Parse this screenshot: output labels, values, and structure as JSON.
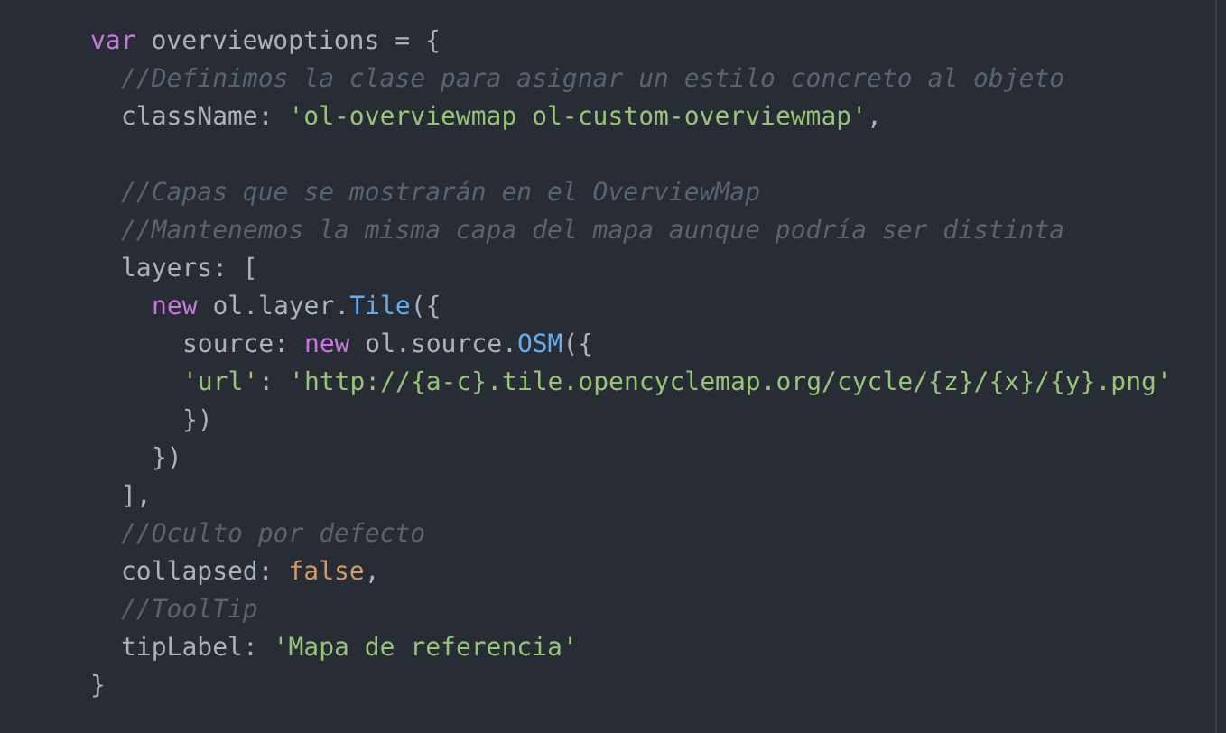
{
  "code": {
    "lines": [
      {
        "tokens": [
          {
            "kind": "keyword",
            "text": "var"
          },
          {
            "kind": "plain",
            "text": " overviewoptions "
          },
          {
            "kind": "punct",
            "text": "= {"
          }
        ],
        "children": [
          {
            "tokens": [
              {
                "kind": "comment",
                "text": "//Definimos la clase para asignar un estilo concreto al objeto"
              }
            ]
          },
          {
            "tokens": [
              {
                "kind": "plain",
                "text": "className"
              },
              {
                "kind": "punct",
                "text": ": "
              },
              {
                "kind": "string",
                "text": "'ol-overviewmap ol-custom-overviewmap'"
              },
              {
                "kind": "punct",
                "text": ","
              }
            ]
          },
          {
            "kind": "blank"
          },
          {
            "tokens": [
              {
                "kind": "comment",
                "text": "//Capas que se mostrarán en el OverviewMap"
              }
            ]
          },
          {
            "tokens": [
              {
                "kind": "comment",
                "text": "//Mantenemos la misma capa del mapa aunque podría ser distinta"
              }
            ]
          },
          {
            "tokens": [
              {
                "kind": "plain",
                "text": "layers"
              },
              {
                "kind": "punct",
                "text": ": ["
              }
            ],
            "children": [
              {
                "tokens": [
                  {
                    "kind": "keyword",
                    "text": "new"
                  },
                  {
                    "kind": "plain",
                    "text": " ol.layer."
                  },
                  {
                    "kind": "type",
                    "text": "Tile"
                  },
                  {
                    "kind": "punct",
                    "text": "({"
                  }
                ],
                "children": [
                  {
                    "tokens": [
                      {
                        "kind": "plain",
                        "text": "source"
                      },
                      {
                        "kind": "punct",
                        "text": ": "
                      },
                      {
                        "kind": "keyword",
                        "text": "new"
                      },
                      {
                        "kind": "plain",
                        "text": " ol.source."
                      },
                      {
                        "kind": "type",
                        "text": "OSM"
                      },
                      {
                        "kind": "punct",
                        "text": "({"
                      }
                    ]
                  },
                  {
                    "tokens": [
                      {
                        "kind": "string",
                        "text": "'url'"
                      },
                      {
                        "kind": "punct",
                        "text": ": "
                      },
                      {
                        "kind": "string",
                        "text": "'http://{a-c}.tile.opencyclemap.org/cycle/{z}/{x}/{y}.png'"
                      }
                    ]
                  },
                  {
                    "tokens": [
                      {
                        "kind": "punct",
                        "text": "})"
                      }
                    ]
                  }
                ]
              },
              {
                "tokens": [
                  {
                    "kind": "punct",
                    "text": "})"
                  }
                ]
              }
            ]
          },
          {
            "tokens": [
              {
                "kind": "punct",
                "text": "],"
              }
            ]
          },
          {
            "tokens": [
              {
                "kind": "comment",
                "text": "//Oculto por defecto"
              }
            ]
          },
          {
            "tokens": [
              {
                "kind": "plain",
                "text": "collapsed"
              },
              {
                "kind": "punct",
                "text": ": "
              },
              {
                "kind": "literal",
                "text": "false"
              },
              {
                "kind": "punct",
                "text": ","
              }
            ]
          },
          {
            "tokens": [
              {
                "kind": "comment",
                "text": "//ToolTip"
              }
            ]
          },
          {
            "tokens": [
              {
                "kind": "plain",
                "text": "tipLabel"
              },
              {
                "kind": "punct",
                "text": ": "
              },
              {
                "kind": "string",
                "text": "'Mapa de referencia'"
              }
            ]
          }
        ]
      },
      {
        "tokens": [
          {
            "kind": "punct",
            "text": "}"
          }
        ]
      }
    ]
  }
}
